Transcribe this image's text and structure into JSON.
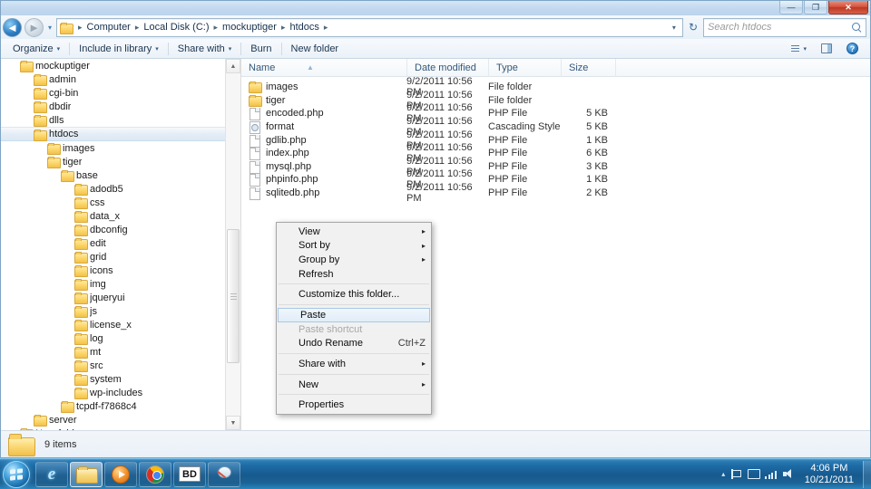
{
  "window": {
    "controls": {
      "minimize": "—",
      "maximize": "❐",
      "close": "✕"
    }
  },
  "address_bar": {
    "back_label": "◄",
    "forward_label": "►",
    "recent_locations_label": "▾",
    "crumbs": [
      "Computer",
      "Local Disk (C:)",
      "mockuptiger",
      "htdocs"
    ],
    "separator": "▸",
    "dropdown_label": "▾",
    "refresh_label": "↻",
    "search_placeholder": "Search htdocs"
  },
  "toolbar": {
    "organize": "Organize",
    "include_in_library": "Include in library",
    "share_with": "Share with",
    "burn": "Burn",
    "new_folder": "New folder",
    "caret": "▾"
  },
  "tree": {
    "items": [
      {
        "label": "mockuptiger",
        "indent": 1,
        "selected": false
      },
      {
        "label": "admin",
        "indent": 2,
        "selected": false
      },
      {
        "label": "cgi-bin",
        "indent": 2,
        "selected": false
      },
      {
        "label": "dbdir",
        "indent": 2,
        "selected": false
      },
      {
        "label": "dlls",
        "indent": 2,
        "selected": false
      },
      {
        "label": "htdocs",
        "indent": 2,
        "selected": true
      },
      {
        "label": "images",
        "indent": 3,
        "selected": false
      },
      {
        "label": "tiger",
        "indent": 3,
        "selected": false
      },
      {
        "label": "base",
        "indent": 4,
        "selected": false
      },
      {
        "label": "adodb5",
        "indent": 5,
        "selected": false
      },
      {
        "label": "css",
        "indent": 5,
        "selected": false
      },
      {
        "label": "data_x",
        "indent": 5,
        "selected": false
      },
      {
        "label": "dbconfig",
        "indent": 5,
        "selected": false
      },
      {
        "label": "edit",
        "indent": 5,
        "selected": false
      },
      {
        "label": "grid",
        "indent": 5,
        "selected": false
      },
      {
        "label": "icons",
        "indent": 5,
        "selected": false
      },
      {
        "label": "img",
        "indent": 5,
        "selected": false
      },
      {
        "label": "jqueryui",
        "indent": 5,
        "selected": false
      },
      {
        "label": "js",
        "indent": 5,
        "selected": false
      },
      {
        "label": "license_x",
        "indent": 5,
        "selected": false
      },
      {
        "label": "log",
        "indent": 5,
        "selected": false
      },
      {
        "label": "mt",
        "indent": 5,
        "selected": false
      },
      {
        "label": "src",
        "indent": 5,
        "selected": false
      },
      {
        "label": "system",
        "indent": 5,
        "selected": false
      },
      {
        "label": "wp-includes",
        "indent": 5,
        "selected": false
      },
      {
        "label": "tcpdf-f7868c4",
        "indent": 4,
        "selected": false
      },
      {
        "label": "server",
        "indent": 2,
        "selected": false
      },
      {
        "label": "New folder",
        "indent": 1,
        "selected": false
      }
    ]
  },
  "file_list": {
    "columns": [
      "Name",
      "Date modified",
      "Type",
      "Size"
    ],
    "sort_indicator": "▲",
    "rows": [
      {
        "name": "images",
        "date": "9/2/2011 10:56 PM",
        "type": "File folder",
        "size": "",
        "icon": "folder"
      },
      {
        "name": "tiger",
        "date": "9/2/2011 10:56 PM",
        "type": "File folder",
        "size": "",
        "icon": "folder"
      },
      {
        "name": "encoded.php",
        "date": "9/2/2011 10:56 PM",
        "type": "PHP File",
        "size": "5 KB",
        "icon": "doc"
      },
      {
        "name": "format",
        "date": "9/2/2011 10:56 PM",
        "type": "Cascading Style S...",
        "size": "5 KB",
        "icon": "css"
      },
      {
        "name": "gdlib.php",
        "date": "9/2/2011 10:56 PM",
        "type": "PHP File",
        "size": "1 KB",
        "icon": "doc"
      },
      {
        "name": "index.php",
        "date": "9/2/2011 10:56 PM",
        "type": "PHP File",
        "size": "6 KB",
        "icon": "doc"
      },
      {
        "name": "mysql.php",
        "date": "9/2/2011 10:56 PM",
        "type": "PHP File",
        "size": "3 KB",
        "icon": "doc"
      },
      {
        "name": "phpinfo.php",
        "date": "9/2/2011 10:56 PM",
        "type": "PHP File",
        "size": "1 KB",
        "icon": "doc"
      },
      {
        "name": "sqlitedb.php",
        "date": "9/2/2011 10:56 PM",
        "type": "PHP File",
        "size": "2 KB",
        "icon": "doc"
      }
    ]
  },
  "status_bar": {
    "text": "9 items"
  },
  "context_menu": {
    "items": [
      {
        "label": "View",
        "type": "submenu",
        "arrow": "▸"
      },
      {
        "label": "Sort by",
        "type": "submenu",
        "arrow": "▸"
      },
      {
        "label": "Group by",
        "type": "submenu",
        "arrow": "▸"
      },
      {
        "label": "Refresh",
        "type": "normal"
      },
      {
        "type": "separator"
      },
      {
        "label": "Customize this folder...",
        "type": "normal"
      },
      {
        "type": "separator"
      },
      {
        "label": "Paste",
        "type": "highlighted"
      },
      {
        "label": "Paste shortcut",
        "type": "disabled"
      },
      {
        "label": "Undo Rename",
        "type": "normal",
        "accel": "Ctrl+Z"
      },
      {
        "type": "separator"
      },
      {
        "label": "Share with",
        "type": "submenu",
        "arrow": "▸"
      },
      {
        "type": "separator"
      },
      {
        "label": "New",
        "type": "submenu",
        "arrow": "▸"
      },
      {
        "type": "separator"
      },
      {
        "label": "Properties",
        "type": "normal"
      }
    ]
  },
  "taskbar": {
    "start_label": "Start",
    "buttons": [
      {
        "name": "internet-explorer",
        "label": "e"
      },
      {
        "name": "windows-explorer",
        "label": ""
      },
      {
        "name": "windows-media-player",
        "label": ""
      },
      {
        "name": "google-chrome",
        "label": ""
      },
      {
        "name": "bd-app",
        "label": "BD"
      },
      {
        "name": "paint-tool-app",
        "label": ""
      }
    ],
    "tray": {
      "arrow": "▴"
    },
    "clock": {
      "time": "4:06 PM",
      "date": "10/21/2011"
    }
  }
}
